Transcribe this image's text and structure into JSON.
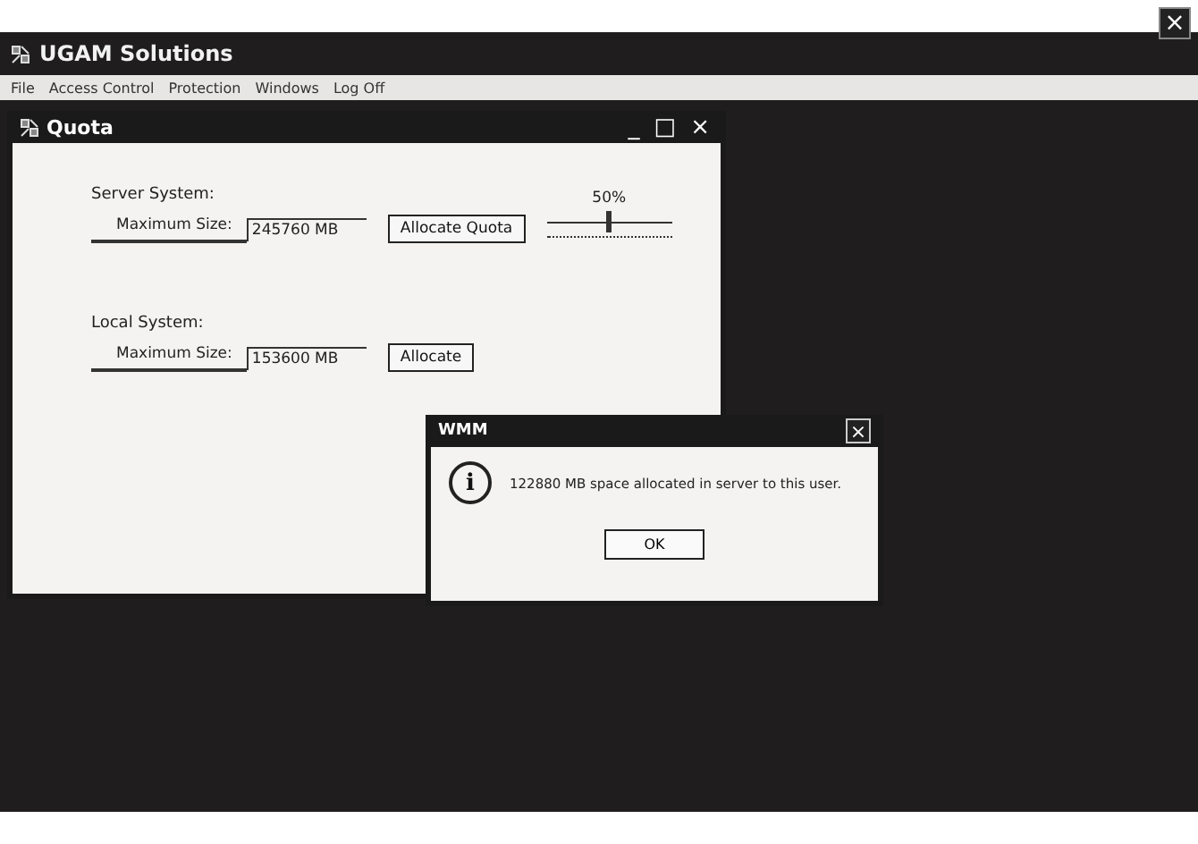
{
  "window": {
    "title": "UGAM Solutions",
    "close": "×"
  },
  "menu": [
    "File",
    "Access Control",
    "Protection",
    "Windows",
    "Log Off"
  ],
  "quota_window": {
    "title": "Quota",
    "controls": [
      "_",
      "□",
      "×"
    ],
    "sections": [
      {
        "heading": "Server System:",
        "size_label": "Maximum Size:",
        "size_value": "245760 MB",
        "button": "Allocate Quota",
        "slider": {
          "reading": "50%",
          "level": 0.5
        }
      },
      {
        "heading": "Local System:",
        "size_label": "Maximum Size:",
        "size_value": "153600 MB",
        "button": "Allocate"
      }
    ]
  },
  "dialog": {
    "title": "WMM",
    "close": "×",
    "icon": "i",
    "message": "122880 MB space allocated in server to this user.",
    "button": "OK"
  }
}
